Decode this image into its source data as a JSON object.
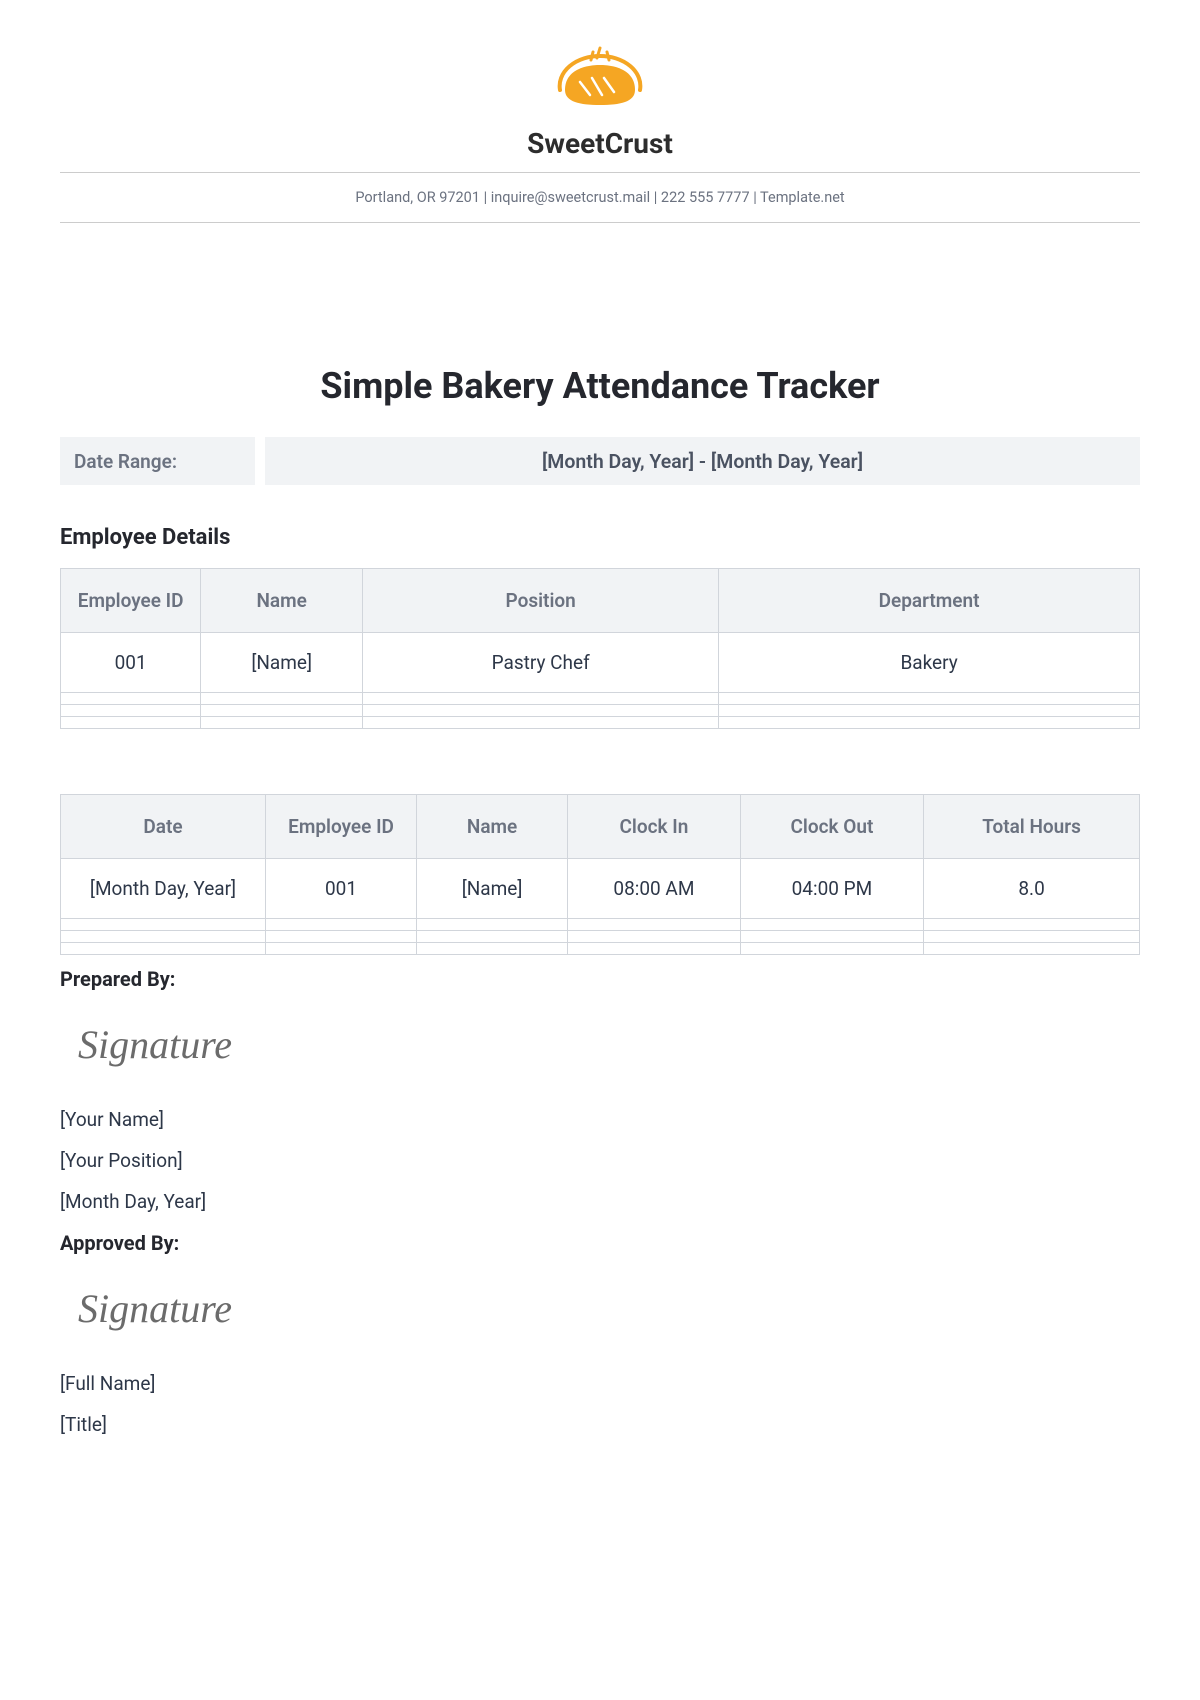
{
  "header": {
    "brand_name": "SweetCrust",
    "contact_line": "Portland, OR 97201 | inquire@sweetcrust.mail  | 222 555 7777 | Template.net"
  },
  "doc_title": "Simple Bakery Attendance Tracker",
  "date_range": {
    "label": "Date Range:",
    "value": "[Month Day, Year]  - [Month Day, Year]"
  },
  "employee_section": {
    "heading": "Employee Details",
    "headers": {
      "id": "Employee ID",
      "name": "Name",
      "position": "Position",
      "department": "Department"
    },
    "rows": [
      {
        "id": "001",
        "name": "[Name]",
        "position": "Pastry Chef",
        "department": "Bakery"
      }
    ]
  },
  "attendance_section": {
    "headers": {
      "date": "Date",
      "id": "Employee ID",
      "name": "Name",
      "clock_in": "Clock In",
      "clock_out": "Clock Out",
      "total_hours": "Total Hours"
    },
    "rows": [
      {
        "date": "[Month Day, Year]",
        "id": "001",
        "name": "[Name]",
        "clock_in": "08:00 AM",
        "clock_out": "04:00 PM",
        "total_hours": "8.0"
      }
    ]
  },
  "prepared_by": {
    "label": "Prepared By:",
    "signature": "Signature",
    "name": "[Your Name]",
    "position": "[Your Position]",
    "date": "[Month Day, Year]"
  },
  "approved_by": {
    "label": "Approved By:",
    "signature": "Signature",
    "name": "[Full Name]",
    "title": "[Title]"
  }
}
